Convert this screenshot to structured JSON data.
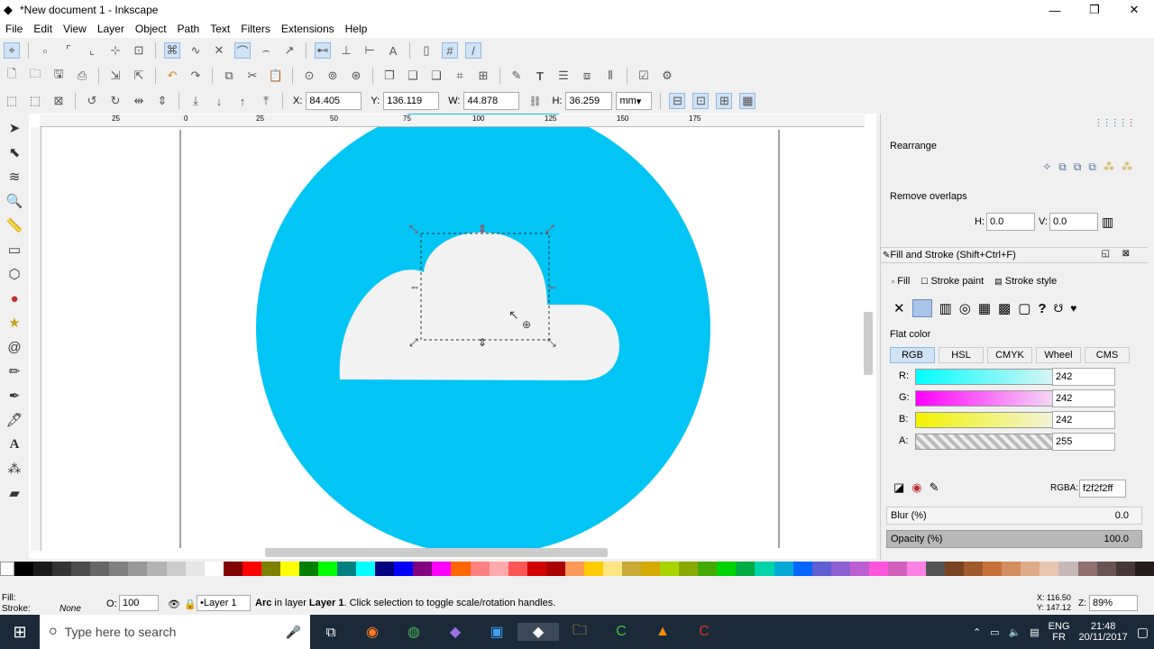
{
  "window": {
    "title": "*New document 1 - Inkscape",
    "minimize": "—",
    "maximize": "❐",
    "close": "✕"
  },
  "menu": [
    "File",
    "Edit",
    "View",
    "Layer",
    "Object",
    "Path",
    "Text",
    "Filters",
    "Extensions",
    "Help"
  ],
  "toolcontrols": {
    "x_label": "X:",
    "x_value": "84.405",
    "y_label": "Y:",
    "y_value": "136.119",
    "w_label": "W:",
    "w_value": "44.878",
    "h_label": "H:",
    "h_value": "36.259",
    "unit": "mm"
  },
  "ruler_ticks": [
    "25",
    "0",
    "25",
    "50",
    "75",
    "100",
    "125",
    "150",
    "175"
  ],
  "align_panel": {
    "rearrange_label": "Rearrange",
    "remove_overlaps_label": "Remove overlaps",
    "h_label": "H:",
    "h_value": "0.0",
    "v_label": "V:",
    "v_value": "0.0"
  },
  "fill_stroke": {
    "title": "Fill and Stroke (Shift+Ctrl+F)",
    "tabs": [
      "Fill",
      "Stroke paint",
      "Stroke style"
    ],
    "flat_color_label": "Flat color",
    "modes": [
      "RGB",
      "HSL",
      "CMYK",
      "Wheel",
      "CMS"
    ],
    "channels": [
      {
        "label": "R:",
        "value": "242"
      },
      {
        "label": "G:",
        "value": "242"
      },
      {
        "label": "B:",
        "value": "242"
      },
      {
        "label": "A:",
        "value": "255"
      }
    ],
    "rgba_label": "RGBA:",
    "rgba_value": "f2f2f2ff",
    "blur_label": "Blur (%)",
    "blur_value": "0.0",
    "opacity_label": "Opacity (%)",
    "opacity_value": "100.0"
  },
  "status": {
    "fill_label": "Fill:",
    "stroke_label": "Stroke:",
    "stroke_value": "None",
    "o_label": "O:",
    "o_value": "100",
    "layer": "•Layer 1",
    "message_obj": "Arc",
    "message_mid": " in layer ",
    "message_layer": "Layer 1",
    "message_end": ". Click selection to toggle scale/rotation handles.",
    "x_coord": "X: 116.50",
    "y_coord": "Y: 147.12",
    "z_label": "Z:",
    "zoom": "89%"
  },
  "taskbar": {
    "search_placeholder": "Type here to search",
    "lang": "ENG",
    "region": "FR",
    "time": "21:48",
    "date": "20/11/2017"
  },
  "colors": {
    "circle": "#00c5f5",
    "cloud": "#f2f2f2",
    "taskbar": "#1a2a3a"
  },
  "palette": [
    "#000000",
    "#1a1a1a",
    "#333333",
    "#4d4d4d",
    "#666666",
    "#808080",
    "#999999",
    "#b3b3b3",
    "#cccccc",
    "#e6e6e6",
    "#ffffff",
    "#800000",
    "#ff0000",
    "#808000",
    "#ffff00",
    "#008000",
    "#00ff00",
    "#008080",
    "#00ffff",
    "#000080",
    "#0000ff",
    "#800080",
    "#ff00ff",
    "#ff6600",
    "#ff8080",
    "#ffaaaa",
    "#ff5555",
    "#d40000",
    "#aa0000",
    "#ff9955",
    "#ffcc00",
    "#ffe680",
    "#c8ab37",
    "#d4aa00",
    "#aad400",
    "#88aa00",
    "#44aa00",
    "#00d400",
    "#00aa44",
    "#00d4aa",
    "#00aad4",
    "#0066ff",
    "#5f5fd3",
    "#8d5fd3",
    "#bc5fd3",
    "#ff55dd",
    "#d35fbc",
    "#ff80e5",
    "#555555",
    "#784421",
    "#a05a2c",
    "#c87137",
    "#d38d5f",
    "#deaa87",
    "#e9c6af",
    "#c8b7b7",
    "#916f6f",
    "#6c5353",
    "#483737",
    "#241c1c"
  ]
}
